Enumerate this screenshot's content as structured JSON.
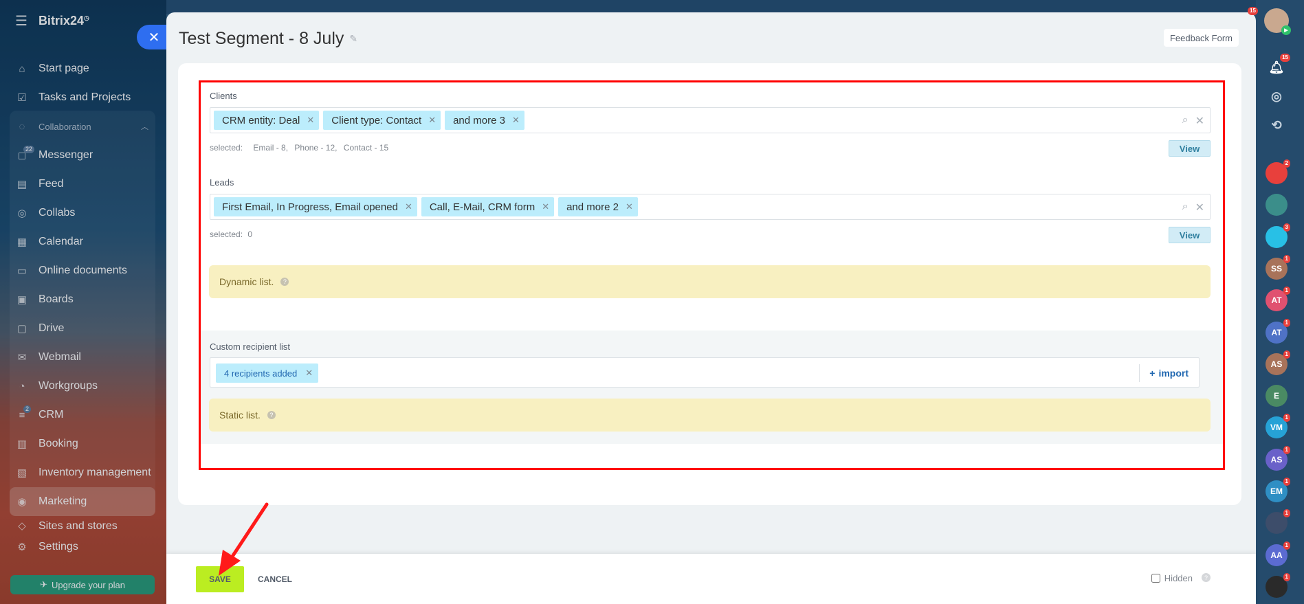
{
  "app": {
    "name": "Bitrix24"
  },
  "sidebar": {
    "items": [
      {
        "label": "Start page",
        "icon": "home-icon"
      },
      {
        "label": "Tasks and Projects",
        "icon": "checkbox-icon"
      },
      {
        "label": "Collaboration",
        "icon": "collab-icon"
      },
      {
        "label": "Messenger",
        "icon": "chat-icon",
        "count": "22"
      },
      {
        "label": "Feed",
        "icon": "feed-icon"
      },
      {
        "label": "Collabs",
        "icon": "collabs-icon"
      },
      {
        "label": "Calendar",
        "icon": "calendar-icon"
      },
      {
        "label": "Online documents",
        "icon": "document-icon"
      },
      {
        "label": "Boards",
        "icon": "board-icon"
      },
      {
        "label": "Drive",
        "icon": "drive-icon"
      },
      {
        "label": "Webmail",
        "icon": "mail-icon"
      },
      {
        "label": "Workgroups",
        "icon": "group-icon"
      },
      {
        "label": "CRM",
        "icon": "crm-icon",
        "count": "2"
      },
      {
        "label": "Booking",
        "icon": "booking-icon"
      },
      {
        "label": "Inventory management",
        "icon": "inventory-icon"
      },
      {
        "label": "Marketing",
        "icon": "marketing-icon"
      },
      {
        "label": "Sites and stores",
        "icon": "sites-icon"
      },
      {
        "label": "Settings",
        "icon": "gear-icon"
      }
    ],
    "upgrade_label": "Upgrade your plan"
  },
  "header": {
    "title": "Test Segment - 8 July",
    "feedback_label": "Feedback Form"
  },
  "clients": {
    "label": "Clients",
    "tags": [
      "CRM entity: Deal",
      "Client type: Contact",
      "and more 3"
    ],
    "selected_label": "selected:",
    "selected_values": [
      "Email - 8,",
      "Phone - 12,",
      "Contact - 15"
    ],
    "view_label": "View"
  },
  "leads": {
    "label": "Leads",
    "tags": [
      "First Email, In Progress, Email opened",
      "Call, E-Mail, CRM form",
      "and more 2"
    ],
    "selected_label": "selected:",
    "selected_values": [
      "0"
    ],
    "view_label": "View"
  },
  "dynamic": {
    "label": "Dynamic list.",
    "help": "?"
  },
  "custom": {
    "label": "Custom recipient list",
    "tag": "4 recipients added",
    "import_label": "import"
  },
  "static": {
    "label": "Static list.",
    "help": "?"
  },
  "footer": {
    "save_label": "SAVE",
    "cancel_label": "CANCEL",
    "hidden_label": "Hidden",
    "hidden_checked": false,
    "help": "?"
  },
  "rightbar": {
    "notifications_count": "15",
    "top_badge": "15",
    "avatars": [
      {
        "initials": "",
        "color": "#e8403c",
        "badge": "2"
      },
      {
        "initials": "",
        "color": "#3b8e8a",
        "badge": ""
      },
      {
        "initials": "",
        "color": "#28c0e6",
        "badge": "3"
      },
      {
        "initials": "SS",
        "color": "#a8735a",
        "badge": "1"
      },
      {
        "initials": "AT",
        "color": "#e05170",
        "badge": "1"
      },
      {
        "initials": "AT",
        "color": "#4f72c6",
        "badge": "1"
      },
      {
        "initials": "AS",
        "color": "#a8735a",
        "badge": "1"
      },
      {
        "initials": "E",
        "color": "#4a8a63",
        "badge": ""
      },
      {
        "initials": "VM",
        "color": "#26a2d6",
        "badge": "1"
      },
      {
        "initials": "AS",
        "color": "#6a61c9",
        "badge": "1"
      },
      {
        "initials": "EM",
        "color": "#2f8fc4",
        "badge": "1"
      },
      {
        "initials": "",
        "color": "#3d4d6a",
        "badge": "1"
      },
      {
        "initials": "AA",
        "color": "#5b6bd1",
        "badge": "1"
      },
      {
        "initials": "",
        "color": "#2a2a2a",
        "badge": "1"
      }
    ]
  },
  "colors": {
    "save_green": "#bbed21",
    "tag_blue": "#bcedfc",
    "highlight_red": "#ff0000",
    "notice_yellow": "#f8f0c1"
  }
}
